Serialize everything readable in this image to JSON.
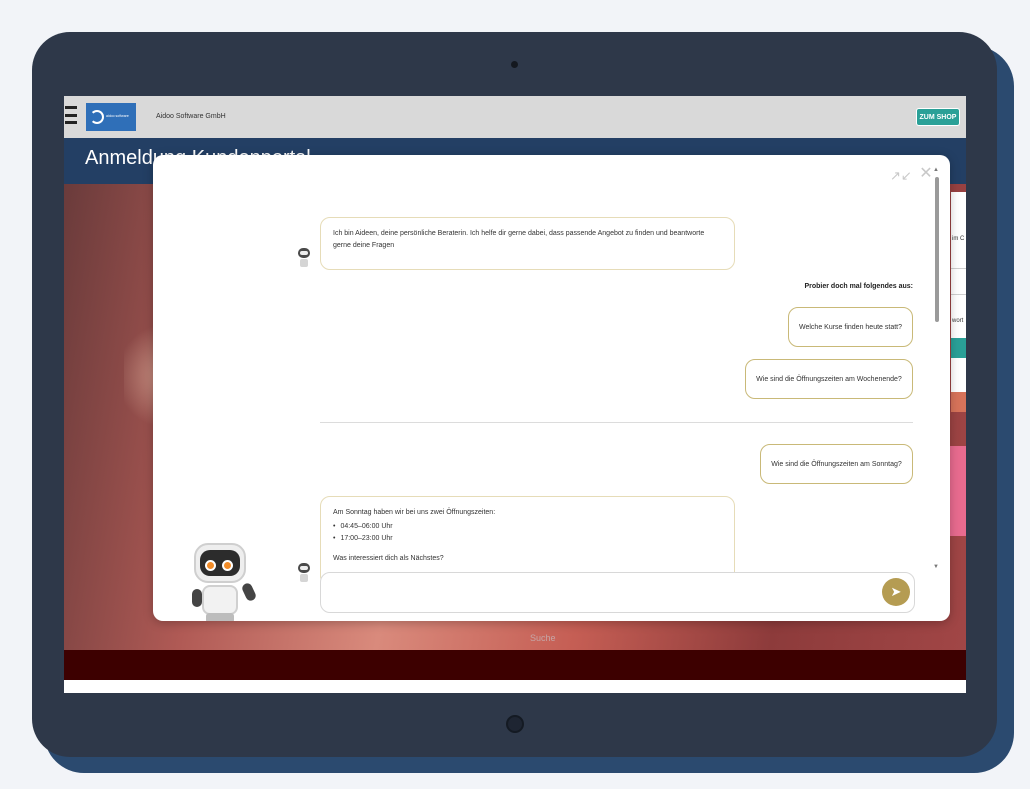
{
  "header": {
    "company": "Aidoo Software GmbH",
    "shop_button": "ZUM SHOP",
    "logo_text": "aidoo software"
  },
  "page": {
    "title": "Anmeldung Kundenportal",
    "side_text_1": "im C",
    "side_text_2": "wort",
    "footer_text": "Suche"
  },
  "chat": {
    "greeting": "Ich bin Aideen, deine persönliche Beraterin. Ich helfe dir gerne dabei, dass passende Angebot zu finden und beantworte gerne deine Fragen",
    "suggest_label": "Probier doch mal folgendes aus:",
    "suggestions": [
      "Welche Kurse finden heute statt?",
      "Wie sind die Öffnungszeiten am Wochenende?"
    ],
    "user_message": "Wie sind die Öffnungszeiten am Sonntag?",
    "bot_reply": {
      "intro": "Am Sonntag haben wir bei uns zwei Öffnungszeiten:",
      "items": [
        "04:45–06:00 Uhr",
        "17:00–23:00 Uhr"
      ],
      "followup": "Was interessiert dich als Nächstes?"
    },
    "input_placeholder": ""
  },
  "colors": {
    "accent_gold": "#b59c52",
    "title_bar": "#233f64",
    "shop_button": "#2aa097"
  },
  "icons": [
    "menu-icon",
    "minimize-icon",
    "close-icon",
    "send-icon",
    "bot-avatar-icon"
  ]
}
